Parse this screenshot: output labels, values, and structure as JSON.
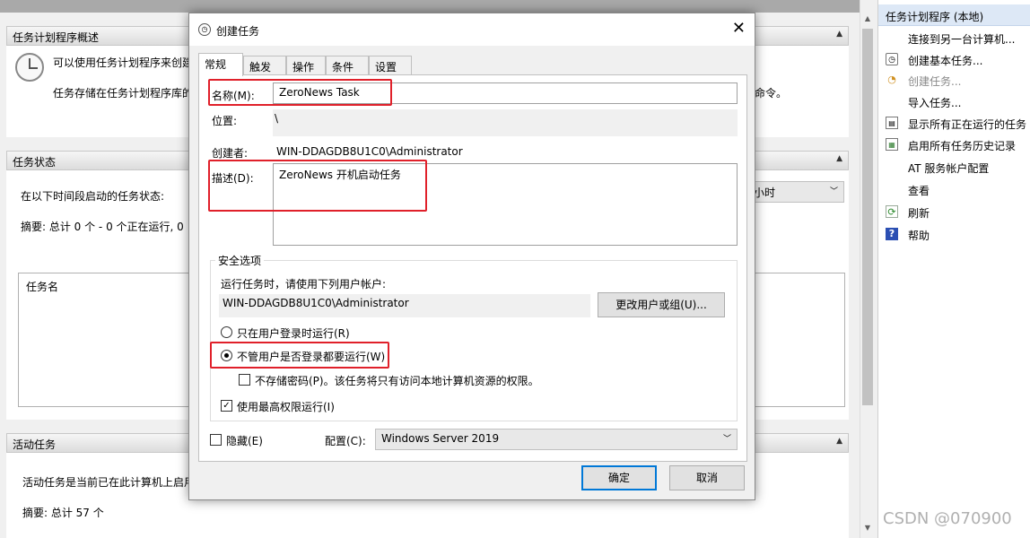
{
  "background": {
    "overview": {
      "header": "任务计划程序概述",
      "line1": "可以使用任务计划程序来创建",
      "line2": "任务存储在任务计划程序库的",
      "line2_tail": "命令。"
    },
    "status": {
      "header": "任务状态",
      "period_label": "在以下时间段启动的任务状态:",
      "period_value": "小时",
      "summary": "摘要: 总计 0 个 - 0 个正在运行, 0",
      "col_task_name": "任务名"
    },
    "active": {
      "header": "活动任务",
      "desc": "活动任务是当前已在此计算机上启用",
      "summary": "摘要: 总计 57 个"
    }
  },
  "actions_pane": {
    "header": "任务计划程序 (本地)",
    "items": [
      {
        "label": "连接到另一台计算机...",
        "icon": "none"
      },
      {
        "label": "创建基本任务...",
        "icon": "create-basic-task-icon"
      },
      {
        "label": "创建任务...",
        "icon": "create-task-icon"
      },
      {
        "label": "导入任务...",
        "icon": "none"
      },
      {
        "label": "显示所有正在运行的任务",
        "icon": "running-tasks-icon"
      },
      {
        "label": "启用所有任务历史记录",
        "icon": "history-icon"
      },
      {
        "label": "AT 服务帐户配置",
        "icon": "none"
      },
      {
        "label": "查看",
        "icon": "none"
      },
      {
        "label": "刷新",
        "icon": "refresh-icon"
      },
      {
        "label": "帮助",
        "icon": "help-icon"
      }
    ],
    "watermark": "CSDN @070900"
  },
  "dialog": {
    "title": "创建任务",
    "tabs": [
      "常规",
      "触发器",
      "操作",
      "条件",
      "设置"
    ],
    "name_label": "名称(M):",
    "name_value": "ZeroNews Task",
    "location_label": "位置:",
    "location_value": "\\",
    "author_label": "创建者:",
    "author_value": "WIN-DDAGDB8U1C0\\Administrator",
    "desc_label": "描述(D):",
    "desc_value": "ZeroNews 开机启动任务",
    "security": {
      "title": "安全选项",
      "run_as_label": "运行任务时，请使用下列用户帐户:",
      "user_account": "WIN-DDAGDB8U1C0\\Administrator",
      "change_user_button": "更改用户或组(U)...",
      "radio_logged_on": "只在用户登录时运行(R)",
      "radio_whether": "不管用户是否登录都要运行(W)",
      "no_store_password": "不存储密码(P)。该任务将只有访问本地计算机资源的权限。",
      "highest_privileges": "使用最高权限运行(I)"
    },
    "hidden_label": "隐藏(E)",
    "configure_label": "配置(C):",
    "configure_value": "Windows Server 2019",
    "ok_button": "确定",
    "cancel_button": "取消"
  }
}
